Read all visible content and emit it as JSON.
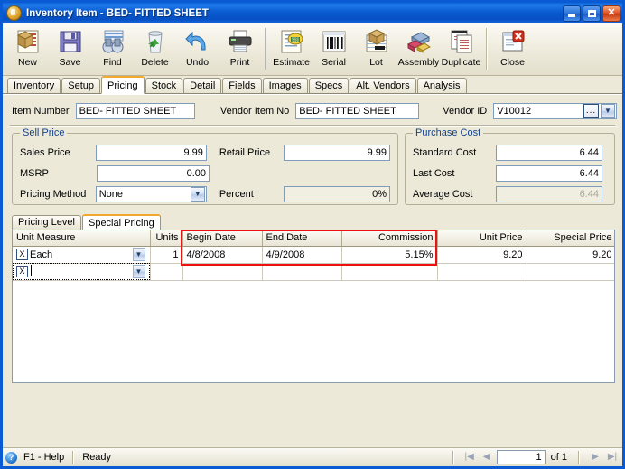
{
  "window": {
    "title": "Inventory Item - BED- FITTED SHEET",
    "icon": "inventory-box-icon",
    "minimize_label": "_",
    "maximize_label": "□",
    "close_label": "✕"
  },
  "toolbar": {
    "buttons": [
      {
        "label": "New",
        "icon": "new-item-icon"
      },
      {
        "label": "Save",
        "icon": "save-floppy-icon"
      },
      {
        "label": "Find",
        "icon": "binoculars-icon"
      },
      {
        "label": "Delete",
        "icon": "recycle-bin-icon"
      },
      {
        "label": "Undo",
        "icon": "undo-arrow-icon"
      },
      {
        "label": "Print",
        "icon": "printer-icon"
      },
      {
        "label": "Estimate",
        "icon": "estimate-icon"
      },
      {
        "label": "Serial",
        "icon": "barcode-icon"
      },
      {
        "label": "Lot",
        "icon": "lot-icon"
      },
      {
        "label": "Assembly",
        "icon": "assembly-icon"
      },
      {
        "label": "Duplicate",
        "icon": "duplicate-icon"
      },
      {
        "label": "Close",
        "icon": "close-window-icon"
      }
    ]
  },
  "tabs": [
    {
      "label": "Inventory",
      "active": false
    },
    {
      "label": "Setup",
      "active": false
    },
    {
      "label": "Pricing",
      "active": true
    },
    {
      "label": "Stock",
      "active": false
    },
    {
      "label": "Detail",
      "active": false
    },
    {
      "label": "Fields",
      "active": false
    },
    {
      "label": "Images",
      "active": false
    },
    {
      "label": "Specs",
      "active": false
    },
    {
      "label": "Alt. Vendors",
      "active": false
    },
    {
      "label": "Analysis",
      "active": false
    }
  ],
  "header_fields": {
    "item_number_label": "Item Number",
    "item_number_value": "BED- FITTED SHEET",
    "vendor_item_no_label": "Vendor Item No",
    "vendor_item_no_value": "BED- FITTED SHEET",
    "vendor_id_label": "Vendor ID",
    "vendor_id_value": "V10012",
    "vendor_id_ellipsis": "...",
    "vendor_id_arrow": "▼"
  },
  "sell_price": {
    "title": "Sell Price",
    "sales_price_label": "Sales Price",
    "sales_price_value": "9.99",
    "retail_price_label": "Retail Price",
    "retail_price_value": "9.99",
    "msrp_label": "MSRP",
    "msrp_value": "0.00",
    "pricing_method_label": "Pricing Method",
    "pricing_method_value": "None",
    "pricing_method_arrow": "▼",
    "percent_label": "Percent",
    "percent_value": "0%"
  },
  "purchase_cost": {
    "title": "Purchase Cost",
    "standard_cost_label": "Standard Cost",
    "standard_cost_value": "6.44",
    "last_cost_label": "Last Cost",
    "last_cost_value": "6.44",
    "average_cost_label": "Average Cost",
    "average_cost_value": "6.44"
  },
  "sub_tabs": [
    {
      "label": "Pricing Level",
      "active": false
    },
    {
      "label": "Special Pricing",
      "active": true
    }
  ],
  "grid": {
    "columns": [
      {
        "label": "Unit Measure",
        "align": "left"
      },
      {
        "label": "Units",
        "align": "right"
      },
      {
        "label": "Begin Date",
        "align": "left"
      },
      {
        "label": "End Date",
        "align": "left"
      },
      {
        "label": "Commission",
        "align": "right"
      },
      {
        "label": "Unit Price",
        "align": "right"
      },
      {
        "label": "Special Price",
        "align": "right"
      }
    ],
    "rows": [
      {
        "delete_label": "X",
        "unit_measure": "Each",
        "arrow": "▼",
        "units": "1",
        "begin_date": "4/8/2008",
        "end_date": "4/9/2008",
        "commission": "5.15%",
        "unit_price": "9.20",
        "special_price": "9.20"
      },
      {
        "delete_label": "X",
        "unit_measure": "",
        "arrow": "▼",
        "units": "",
        "begin_date": "",
        "end_date": "",
        "commission": "",
        "unit_price": "",
        "special_price": ""
      }
    ],
    "highlight_color": "#ee1111"
  },
  "statusbar": {
    "help_icon": "help-question-icon",
    "help_label": "F1 - Help",
    "status_text": "Ready",
    "first_arrow": "|◀",
    "prev_arrow": "◀",
    "page_value": "1",
    "of_label": "of  1",
    "next_arrow": "▶",
    "last_arrow": "▶|"
  }
}
